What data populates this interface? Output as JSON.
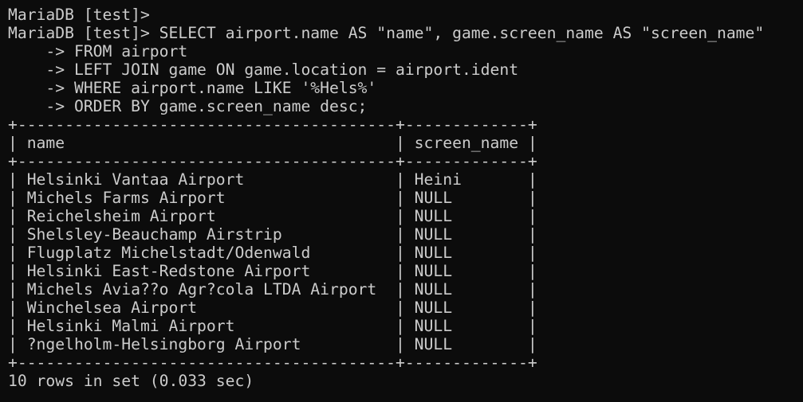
{
  "terminal": {
    "lines": [
      "MariaDB [test]>",
      "MariaDB [test]> SELECT airport.name AS \"name\", game.screen_name AS \"screen_name\"",
      "    -> FROM airport",
      "    -> LEFT JOIN game ON game.location = airport.ident",
      "    -> WHERE airport.name LIKE '%Hels%'",
      "    -> ORDER BY game.screen_name desc;",
      "+----------------------------------------+-------------+",
      "| name                                   | screen_name |",
      "+----------------------------------------+-------------+",
      "| Helsinki Vantaa Airport                | Heini       |",
      "| Michels Farms Airport                  | NULL        |",
      "| Reichelsheim Airport                   | NULL        |",
      "| Shelsley-Beauchamp Airstrip            | NULL        |",
      "| Flugplatz Michelstadt/Odenwald         | NULL        |",
      "| Helsinki East-Redstone Airport         | NULL        |",
      "| Michels Avia??o Agr?cola LTDA Airport  | NULL        |",
      "| Winchelsea Airport                     | NULL        |",
      "| Helsinki Malmi Airport                 | NULL        |",
      "| ?ngelholm-Helsingborg Airport          | NULL        |",
      "+----------------------------------------+-------------+",
      "10 rows in set (0.033 sec)"
    ]
  },
  "colors": {
    "background": "#0c0c0c",
    "text": "#cccccc"
  }
}
